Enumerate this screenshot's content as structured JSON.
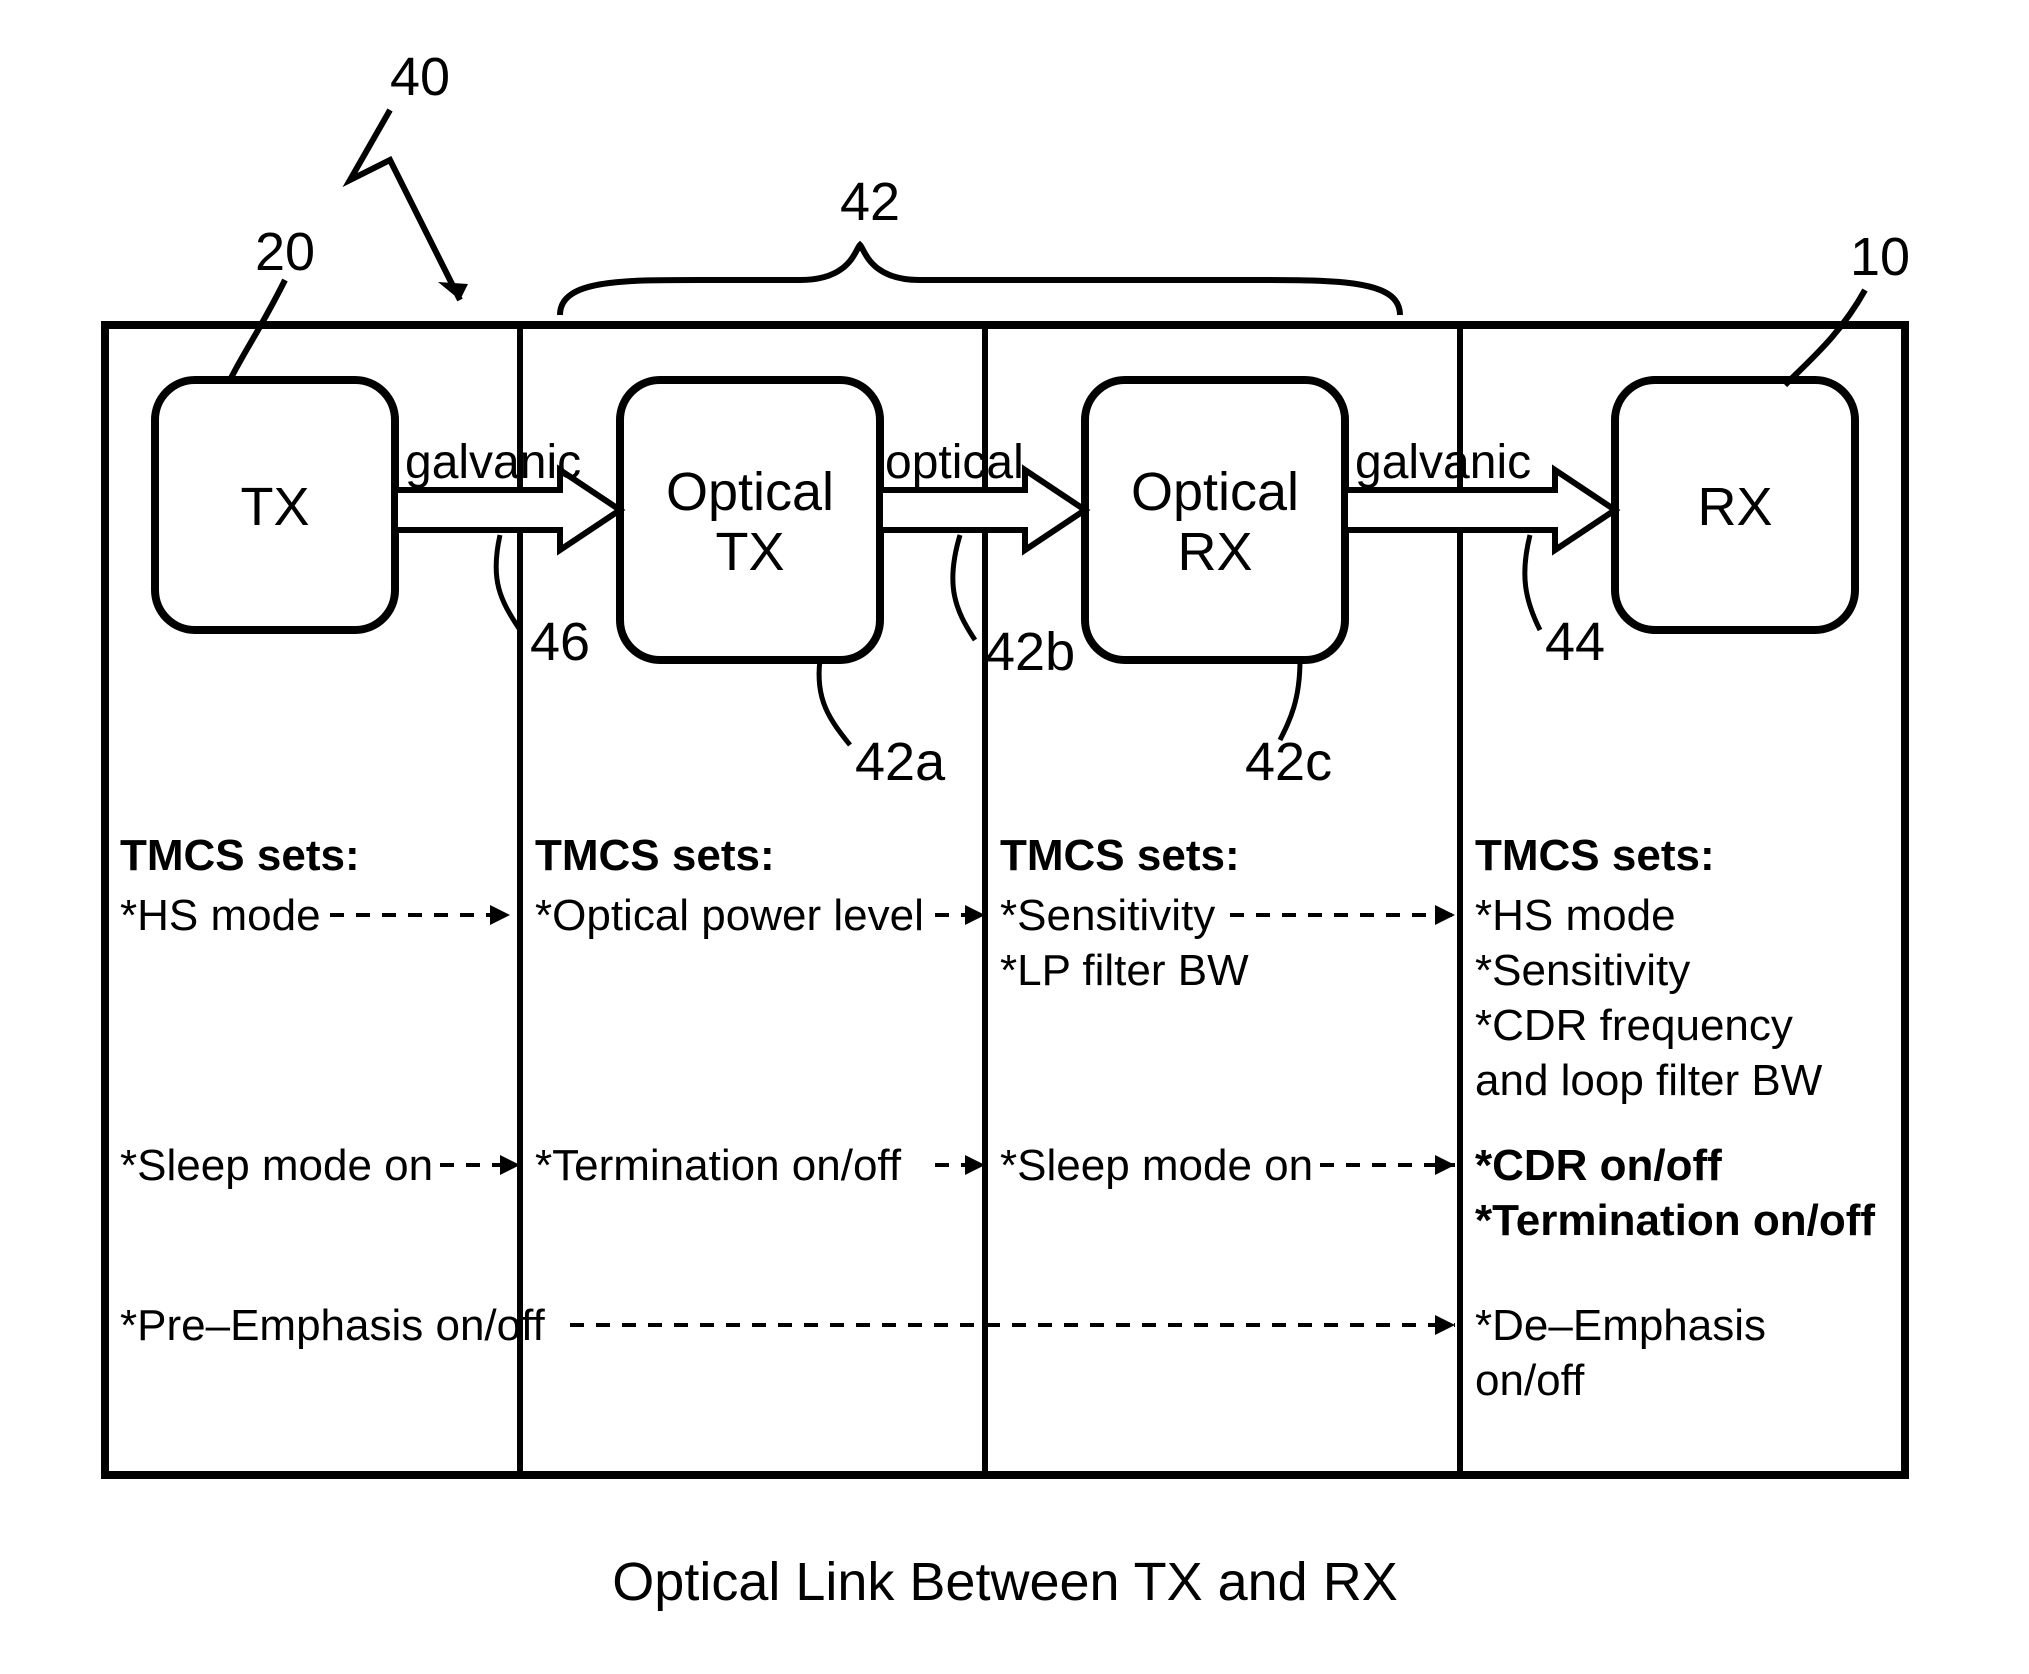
{
  "figure": {
    "label_40": "40",
    "label_20": "20",
    "label_42": "42",
    "label_10": "10",
    "label_46": "46",
    "label_42a": "42a",
    "label_42b": "42b",
    "label_42c": "42c",
    "label_44": "44",
    "caption": "Optical Link Between TX and RX"
  },
  "blocks": {
    "tx": "TX",
    "optical_tx_l1": "Optical",
    "optical_tx_l2": "TX",
    "optical_rx_l1": "Optical",
    "optical_rx_l2": "RX",
    "rx": "RX"
  },
  "arrow_labels": {
    "galvanic_l": "galvanic",
    "optical": "optical",
    "galvanic_r": "galvanic"
  },
  "tmcs_header": "TMCS  sets:",
  "col1": {
    "r1": "*HS mode",
    "r2": "*Sleep mode on",
    "r3": "*Pre–Emphasis on/off"
  },
  "col2": {
    "r1": "*Optical power level",
    "r2": "*Termination on/off"
  },
  "col3": {
    "r1a": "*Sensitivity",
    "r1b": "*LP filter BW",
    "r2": "*Sleep mode on"
  },
  "col4": {
    "r1a": "*HS mode",
    "r1b": "*Sensitivity",
    "r1c": "*CDR frequency",
    "r1d": "and loop filter BW",
    "r2a": "*CDR on/off",
    "r2b": "*Termination on/off",
    "r3a": "*De–Emphasis",
    "r3b": "on/off"
  }
}
